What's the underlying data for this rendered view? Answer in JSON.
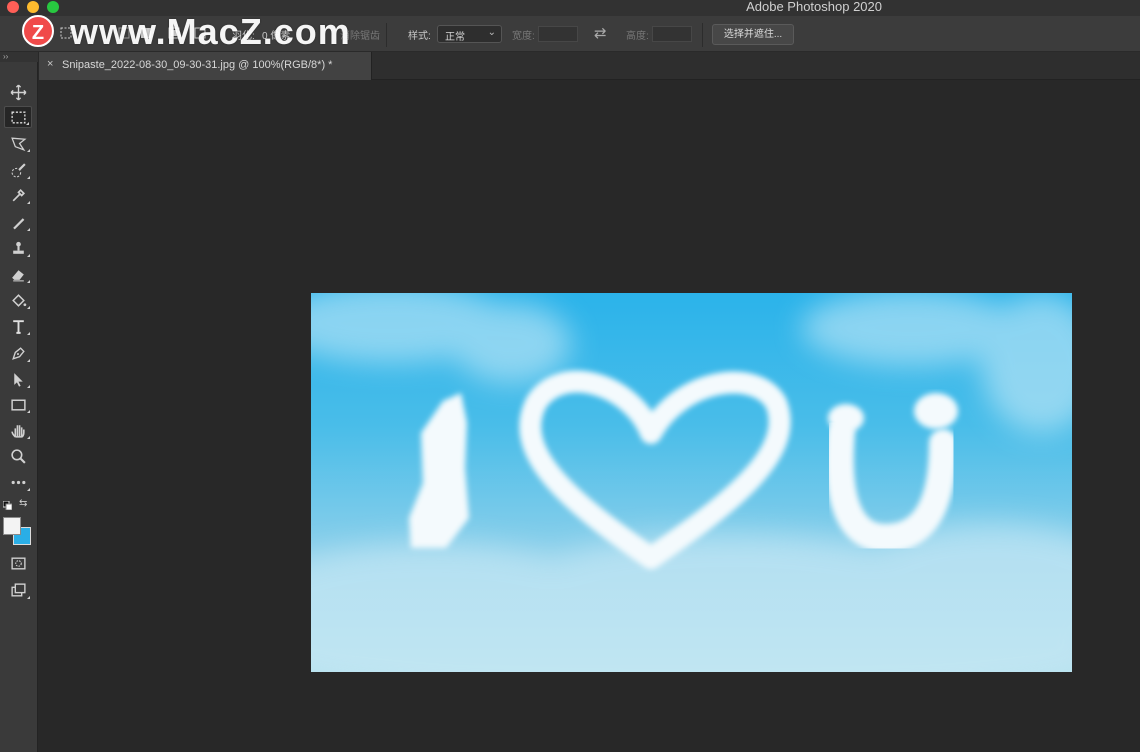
{
  "window": {
    "app_title": "Adobe Photoshop 2020"
  },
  "watermark": {
    "logo_letter": "Z",
    "text": "www.MacZ.com"
  },
  "options_bar": {
    "feather_label": "羽化:",
    "feather_value": "0 像素",
    "antialias_label": "消除锯齿",
    "style_label": "样式:",
    "style_value": "正常",
    "width_label": "宽度:",
    "width_value": "",
    "height_label": "高度:",
    "height_value": "",
    "mask_button_label": "选择并遮住..."
  },
  "document_tab": {
    "close_glyph": "×",
    "label": "Snipaste_2022-08-30_09-30-31.jpg @ 100%(RGB/8*) *"
  },
  "tools_panel": {
    "collapse_glyph": "››",
    "tools": [
      {
        "name": "move-tool",
        "icon": "move-icon"
      },
      {
        "name": "rectangular-marquee-tool",
        "icon": "marquee-icon",
        "active": true
      },
      {
        "name": "lasso-tool",
        "icon": "lasso-icon"
      },
      {
        "name": "quick-selection-tool",
        "icon": "quick-selection-icon"
      },
      {
        "name": "eyedropper-tool",
        "icon": "eyedropper-icon"
      },
      {
        "name": "brush-tool",
        "icon": "brush-icon"
      },
      {
        "name": "clone-stamp-tool",
        "icon": "stamp-icon"
      },
      {
        "name": "eraser-tool",
        "icon": "eraser-icon"
      },
      {
        "name": "paint-bucket-tool",
        "icon": "bucket-icon"
      },
      {
        "name": "type-tool",
        "icon": "type-icon"
      },
      {
        "name": "pen-tool",
        "icon": "pen-icon"
      },
      {
        "name": "path-selection-tool",
        "icon": "arrow-icon"
      },
      {
        "name": "rectangle-tool",
        "icon": "rectangle-icon"
      },
      {
        "name": "hand-tool",
        "icon": "hand-icon"
      },
      {
        "name": "zoom-tool",
        "icon": "zoom-icon"
      },
      {
        "name": "more-tools",
        "icon": "ellipsis-icon"
      }
    ],
    "foreground_color": "#f3f3f3",
    "background_color": "#2aaee6"
  },
  "document": {
    "image_subject": "sky-with-clouds"
  }
}
